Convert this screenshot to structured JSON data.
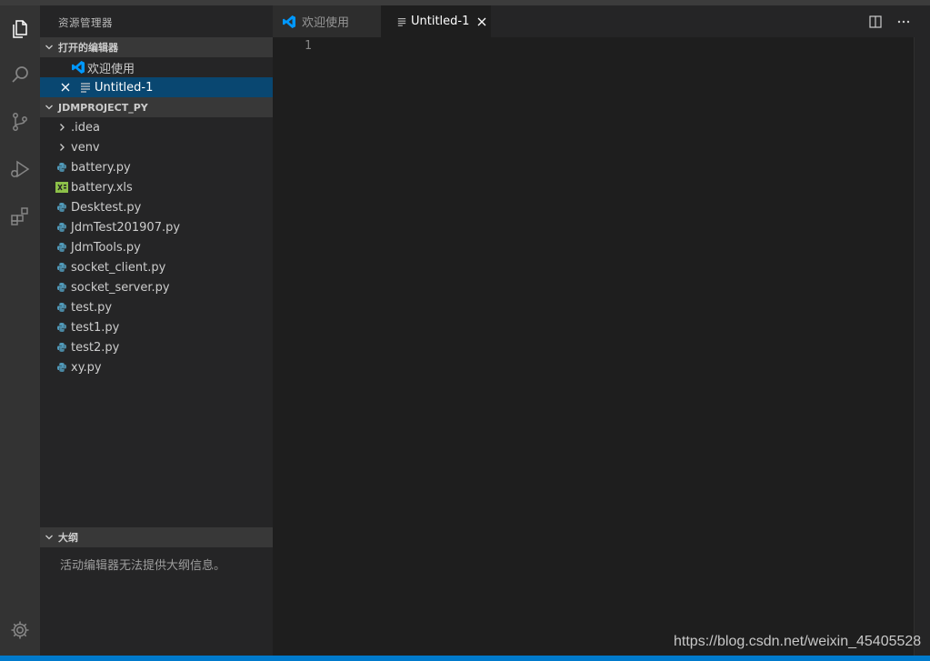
{
  "explorer": {
    "title": "资源管理器",
    "open_editors": {
      "header": "打开的编辑器",
      "items": [
        {
          "label": "欢迎使用"
        },
        {
          "label": "Untitled-1"
        }
      ]
    },
    "project": {
      "header": "JDMPROJECT_PY",
      "folders": [
        ".idea",
        "venv"
      ],
      "files": [
        "battery.py",
        "battery.xls",
        "Desktest.py",
        "JdmTest201907.py",
        "JdmTools.py",
        "socket_client.py",
        "socket_server.py",
        "test.py",
        "test1.py",
        "test2.py",
        "xy.py"
      ]
    },
    "outline": {
      "header": "大纲",
      "message": "活动编辑器无法提供大纲信息。"
    }
  },
  "tabs": [
    {
      "label": "欢迎使用"
    },
    {
      "label": "Untitled-1"
    }
  ],
  "editor": {
    "line_number": "1"
  },
  "watermark": "https://blog.csdn.net/weixin_45405528",
  "colors": {
    "activity_bar": "#333333",
    "sidebar": "#252526",
    "editor": "#1e1e1e",
    "selection": "#094771",
    "status_bar": "#007acc",
    "vscode_blue": "#0098ff",
    "python_blue": "#519aba",
    "excel_green": "#8dc149"
  },
  "icons": {
    "activity": [
      "files-icon",
      "search-icon",
      "source-control-icon",
      "run-debug-icon",
      "extensions-icon",
      "settings-gear-icon"
    ],
    "file_types": {
      "py": "python-icon",
      "xls": "excel-icon"
    }
  }
}
